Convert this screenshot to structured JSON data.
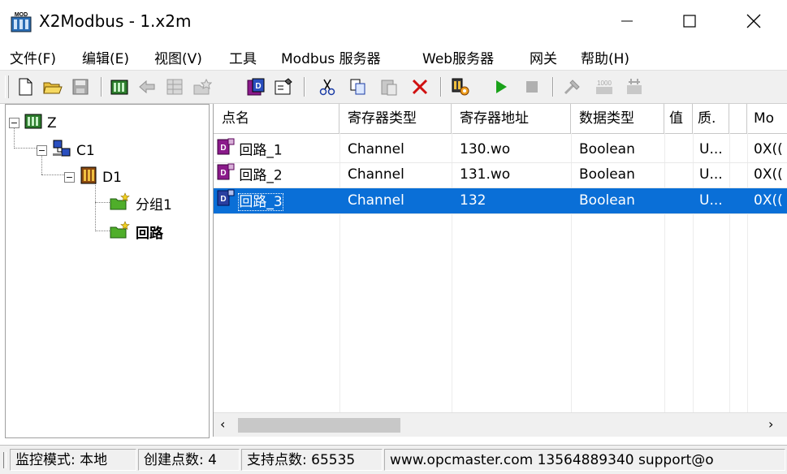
{
  "window": {
    "title": "X2Modbus - 1.x2m",
    "app_icon_text": "MOD"
  },
  "menu": [
    {
      "label": "文件(F)"
    },
    {
      "label": "编辑(E)"
    },
    {
      "label": "视图(V)"
    },
    {
      "label": "工具"
    },
    {
      "label": "Modbus 服务器"
    },
    {
      "label": "Web服务器"
    },
    {
      "label": "网关"
    },
    {
      "label": "帮助(H)"
    }
  ],
  "toolbar_icons": [
    "new-file-icon",
    "open-folder-icon",
    "save-icon",
    "device-icon",
    "import-icon",
    "table-icon",
    "add-group-icon",
    "add-point-icon",
    "properties-icon",
    "cut-icon",
    "copy-icon",
    "paste-icon",
    "delete-icon",
    "settings-icon",
    "start-icon",
    "stop-icon",
    "tools-icon",
    "address-icon",
    "export-icon"
  ],
  "tree": {
    "root": "Z",
    "channel": "C1",
    "device": "D1",
    "groups": [
      "分组1",
      "回路"
    ]
  },
  "grid": {
    "columns": [
      "点名",
      "寄存器类型",
      "寄存器地址",
      "数据类型",
      "值",
      "质.",
      "Mo"
    ],
    "rows": [
      {
        "name": "回路_1",
        "reg_type": "Channel",
        "reg_addr": "130.wo",
        "data_type": "Boolean",
        "value": "",
        "quality": "U...",
        "modbus": "0X(("
      },
      {
        "name": "回路_2",
        "reg_type": "Channel",
        "reg_addr": "131.wo",
        "data_type": "Boolean",
        "value": "",
        "quality": "U...",
        "modbus": "0X(("
      },
      {
        "name": "回路_3",
        "reg_type": "Channel",
        "reg_addr": "132",
        "data_type": "Boolean",
        "value": "",
        "quality": "U...",
        "modbus": "0X(("
      }
    ],
    "selected_row": 2
  },
  "status": {
    "mode": "监控模式: 本地",
    "created": "创建点数: 4",
    "supported": "支持点数: 65535",
    "contact": "www.opcmaster.com 13564889340 support@o"
  },
  "colors": {
    "selection": "#0a6fd7",
    "start_green": "#1aa21a",
    "delete_red": "#d01010"
  }
}
